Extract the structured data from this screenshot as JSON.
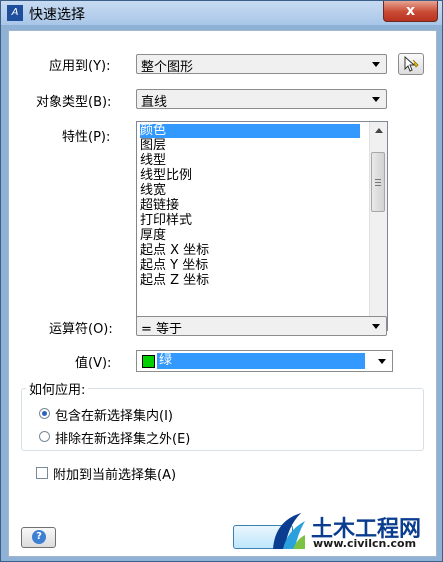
{
  "window": {
    "title": "快速选择",
    "close_label": "x"
  },
  "apply_to": {
    "label": "应用到(Y):",
    "value": "整个图形"
  },
  "object_type": {
    "label": "对象类型(B):",
    "value": "直线"
  },
  "properties": {
    "label": "特性(P):",
    "items": [
      "颜色",
      "图层",
      "线型",
      "线型比例",
      "线宽",
      "超链接",
      "打印样式",
      "厚度",
      "起点 X 坐标",
      "起点 Y 坐标",
      "起点 Z 坐标"
    ],
    "selected_index": 0
  },
  "operator": {
    "label": "运算符(O):",
    "value": "= 等于"
  },
  "value": {
    "label": "值(V):",
    "value": "绿",
    "swatch_color": "#00d000"
  },
  "how_to_apply": {
    "title": "如何应用:",
    "include_label": "包含在新选择集内(I)",
    "exclude_label": "排除在新选择集之外(E)",
    "selected": "include"
  },
  "append": {
    "label": "附加到当前选择集(A)",
    "checked": false
  },
  "watermark": {
    "name": "土木工程网",
    "url": "www.civilcn.com"
  }
}
